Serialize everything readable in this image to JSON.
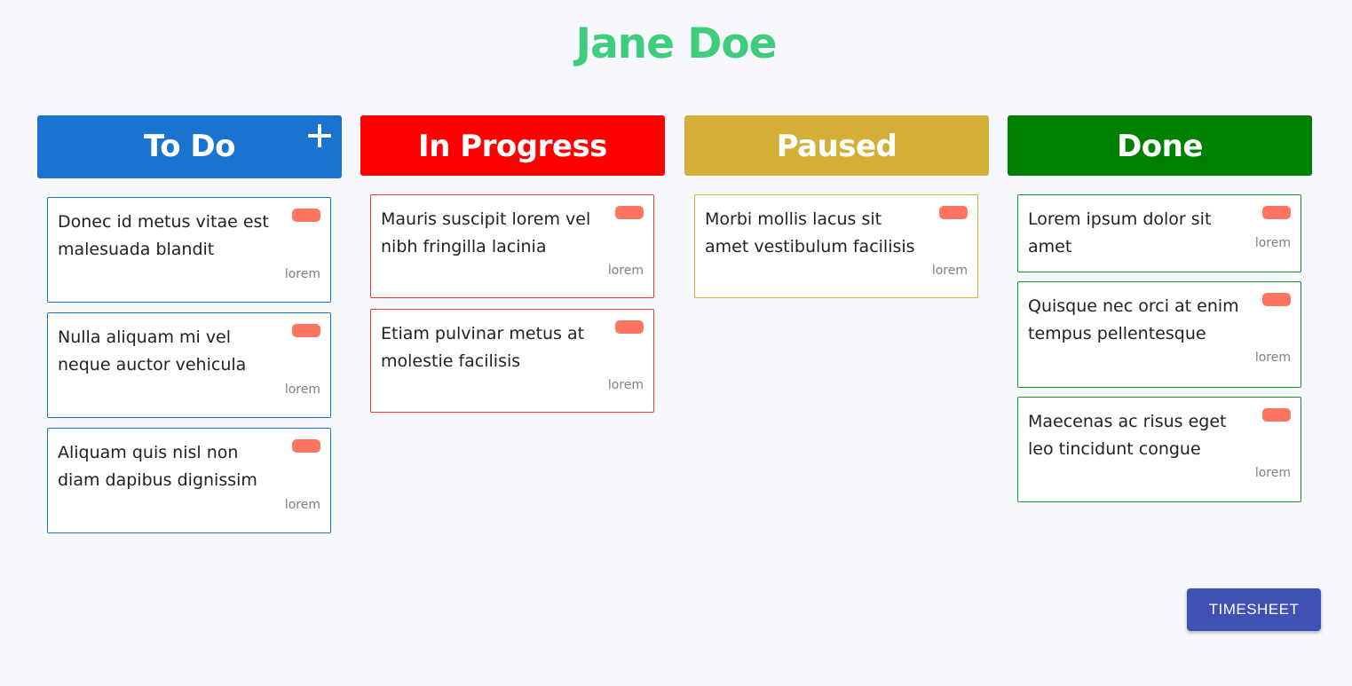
{
  "user": {
    "name": "Jane Doe"
  },
  "columns": [
    {
      "title": "To Do",
      "color": "#1a73cf",
      "has_add_button": true,
      "add_icon": "plus-icon",
      "cards": [
        {
          "title": "Donec id metus vitae est malesuada blandit",
          "tag": "lorem"
        },
        {
          "title": "Nulla aliquam mi vel neque auctor vehicula",
          "tag": "lorem"
        },
        {
          "title": "Aliquam quis nisl non diam dapibus dignissim",
          "tag": "lorem"
        }
      ]
    },
    {
      "title": "In Progress",
      "color": "#ff0000",
      "has_add_button": false,
      "cards": [
        {
          "title": "Mauris suscipit lorem vel nibh fringilla lacinia",
          "tag": "lorem"
        },
        {
          "title": "Etiam pulvinar metus at molestie facilisis",
          "tag": "lorem"
        }
      ]
    },
    {
      "title": "Paused",
      "color": "#d4af37",
      "has_add_button": false,
      "cards": [
        {
          "title": "Morbi mollis lacus sit amet vestibulum facilisis",
          "tag": "lorem"
        }
      ]
    },
    {
      "title": "Done",
      "color": "#008000",
      "has_add_button": false,
      "cards": [
        {
          "title": "Lorem ipsum dolor sit amet",
          "tag": "lorem"
        },
        {
          "title": "Quisque nec orci at enim tempus pellentesque",
          "tag": "lorem"
        },
        {
          "title": "Maecenas ac risus eget leo tincidunt congue",
          "tag": "lorem"
        }
      ]
    }
  ],
  "card_flag_color": "#ff7560",
  "actions": {
    "timesheet_label": "TIMESHEET",
    "timesheet_color": "#3f51b5"
  }
}
